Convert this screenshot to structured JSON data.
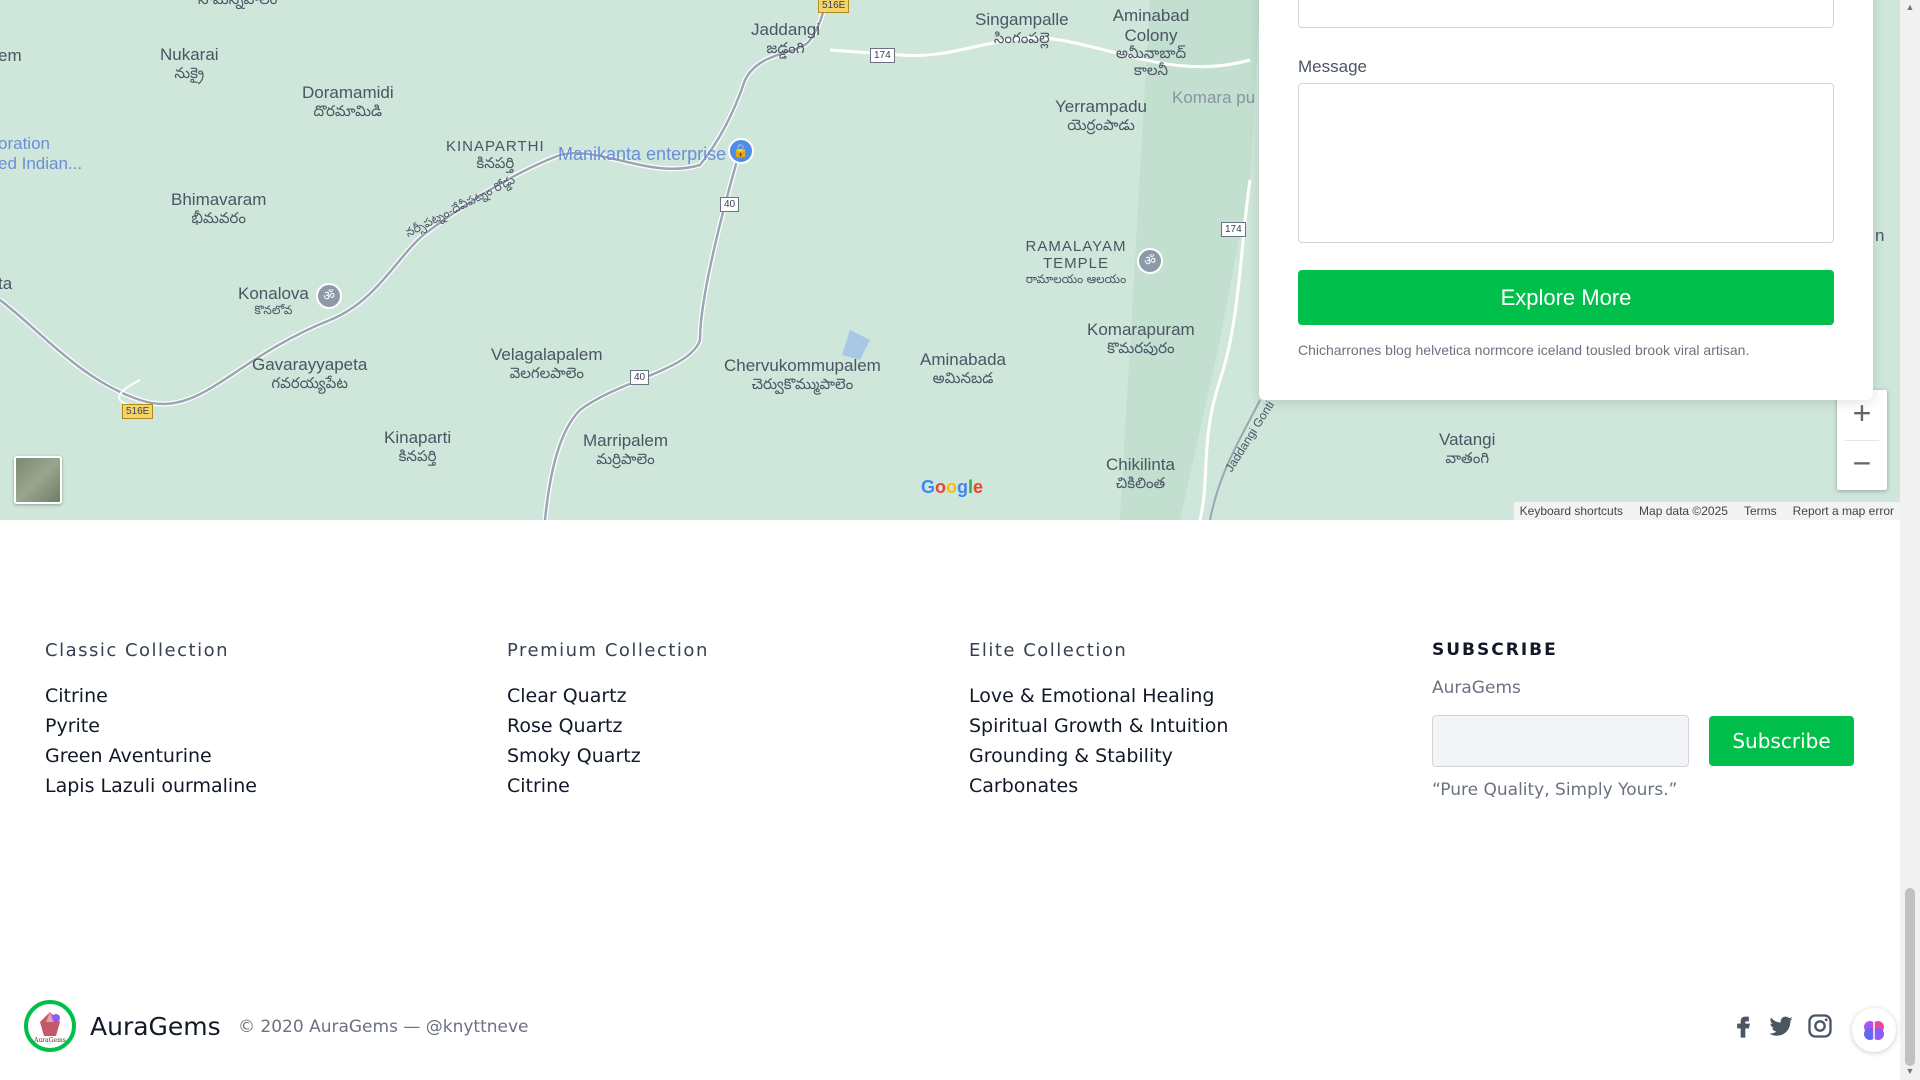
{
  "map": {
    "places": [
      {
        "en": "Nukarai",
        "te": "నుక్రై"
      },
      {
        "en": "Doramamidi",
        "te": "దొరమామిడి"
      },
      {
        "en": "Bhimavaram",
        "te": "భీమవరం"
      },
      {
        "en": "KINAPARTHI",
        "te": "కినపర్తి"
      },
      {
        "en": "Jaddangi",
        "te": "జడ్డంగి"
      },
      {
        "en": "Singampalle",
        "te": "సింగంపల్లె"
      },
      {
        "en": "Aminabad Colony",
        "te": "అమీనాబాద్ కాలనీ"
      },
      {
        "en": "Yerrampadu",
        "te": "యెర్రంపాడు"
      },
      {
        "en": "RAMALAYAM TEMPLE",
        "te": "రామాలయం ఆలయం"
      },
      {
        "en": "Konalova",
        "te": "కొనలోవ"
      },
      {
        "en": "Gavarayyapeta",
        "te": "గవరయ్యపేట"
      },
      {
        "en": "Velagalapalem",
        "te": "వెలగలపాలెం"
      },
      {
        "en": "Chervukommupalem",
        "te": "చెర్వుకొమ్ముపాలెం"
      },
      {
        "en": "Aminabada",
        "te": "అమినబడ"
      },
      {
        "en": "Komarapuram",
        "te": "కొమరపురం"
      },
      {
        "en": "Kinaparti",
        "te": "కినపర్తి"
      },
      {
        "en": "Marripalem",
        "te": "మర్రిపాలెం"
      },
      {
        "en": "Chikilinta",
        "te": "చికిలింత"
      },
      {
        "en": "Vatangi",
        "te": "వాతంగి"
      }
    ],
    "poi": "Manikanta enterprise",
    "edge_labels": {
      "top_left": "em",
      "left_1": "oration",
      "left_2": "ed Indian...",
      "left_3": "ta",
      "top_partial": "Komara pu",
      "right_partial": "n",
      "top_cut": "సోమన్నపాలెం",
      "road_text": "నర్సీపట్నం-దేవీపట్నం రోడ్డు",
      "road_jaddangi": "Jaddangi Gonti"
    },
    "shields": {
      "r516e_top": "516E",
      "r174_a": "174",
      "r40_a": "40",
      "r174_b": "174",
      "r40_b": "40",
      "r516e_bottom": "516E"
    },
    "google": "Google",
    "attribution": [
      "Keyboard shortcuts",
      "Map data ©2025",
      "Terms",
      "Report a map error"
    ],
    "zoom_in": "+",
    "zoom_out": "−"
  },
  "contact": {
    "message_label": "Message",
    "explore_label": "Explore More",
    "note": "Chicharrones blog helvetica normcore iceland tousled brook viral artisan."
  },
  "footer": {
    "columns": [
      {
        "title": "Classic Collection",
        "items": [
          "Citrine",
          "Pyrite",
          "Green Aventurine",
          "Lapis Lazuli ourmaline"
        ]
      },
      {
        "title": "Premium Collection",
        "items": [
          "Clear Quartz",
          "Rose Quartz",
          "Smoky Quartz",
          "Citrine"
        ]
      },
      {
        "title": "Elite Collection",
        "items": [
          "Love & Emotional Healing",
          "Spiritual Growth & Intuition",
          "Grounding & Stability",
          "Carbonates"
        ]
      }
    ],
    "subscribe": {
      "title": "SUBSCRIBE",
      "label": "AuraGems",
      "button": "Subscribe",
      "quote": "“Pure Quality, Simply Yours.”"
    },
    "brand": "AuraGems",
    "logo_text": "AuraGems",
    "copyright": "© 2020 AuraGems — @knyttneve",
    "social": [
      "facebook-icon",
      "twitter-icon",
      "instagram-icon"
    ]
  },
  "colors": {
    "accent": "#00c04b",
    "map_bg": "#cfe6da"
  }
}
